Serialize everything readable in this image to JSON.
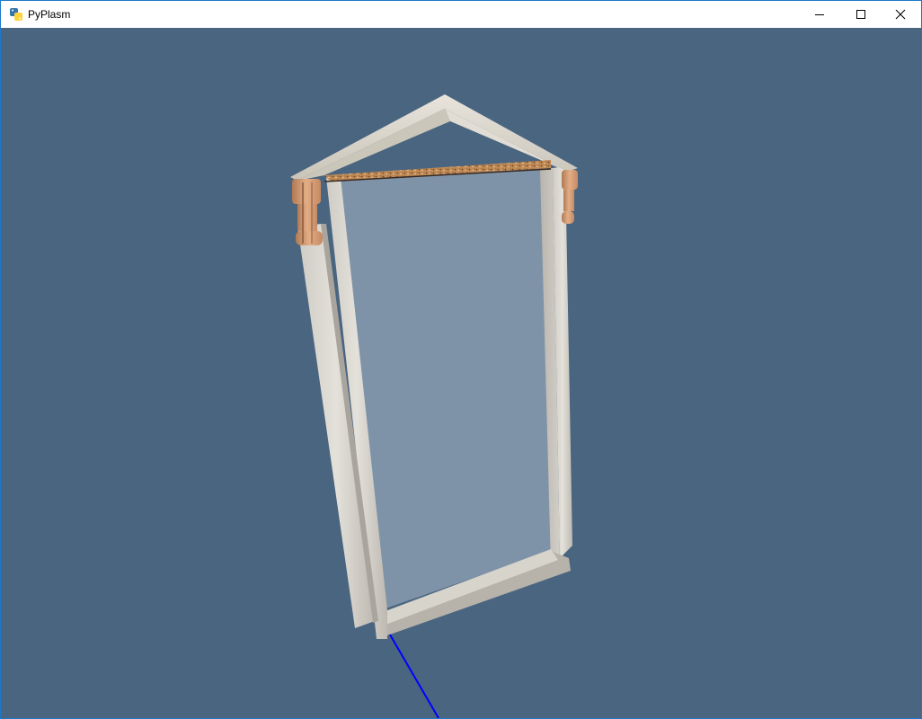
{
  "window": {
    "title": "PyPlasm",
    "app_icon": "python-icon",
    "controls": {
      "minimize_icon": "minimize-icon",
      "maximize_icon": "maximize-icon",
      "close_icon": "close-icon"
    }
  },
  "viewport": {
    "background_color": "#4a6580",
    "model": "window-frame-with-pediment",
    "axis_color": "#0000ff",
    "glass_color": "#7f93a8",
    "marble_color": "#d9d6d0",
    "wood_color": "#d9a27a"
  }
}
